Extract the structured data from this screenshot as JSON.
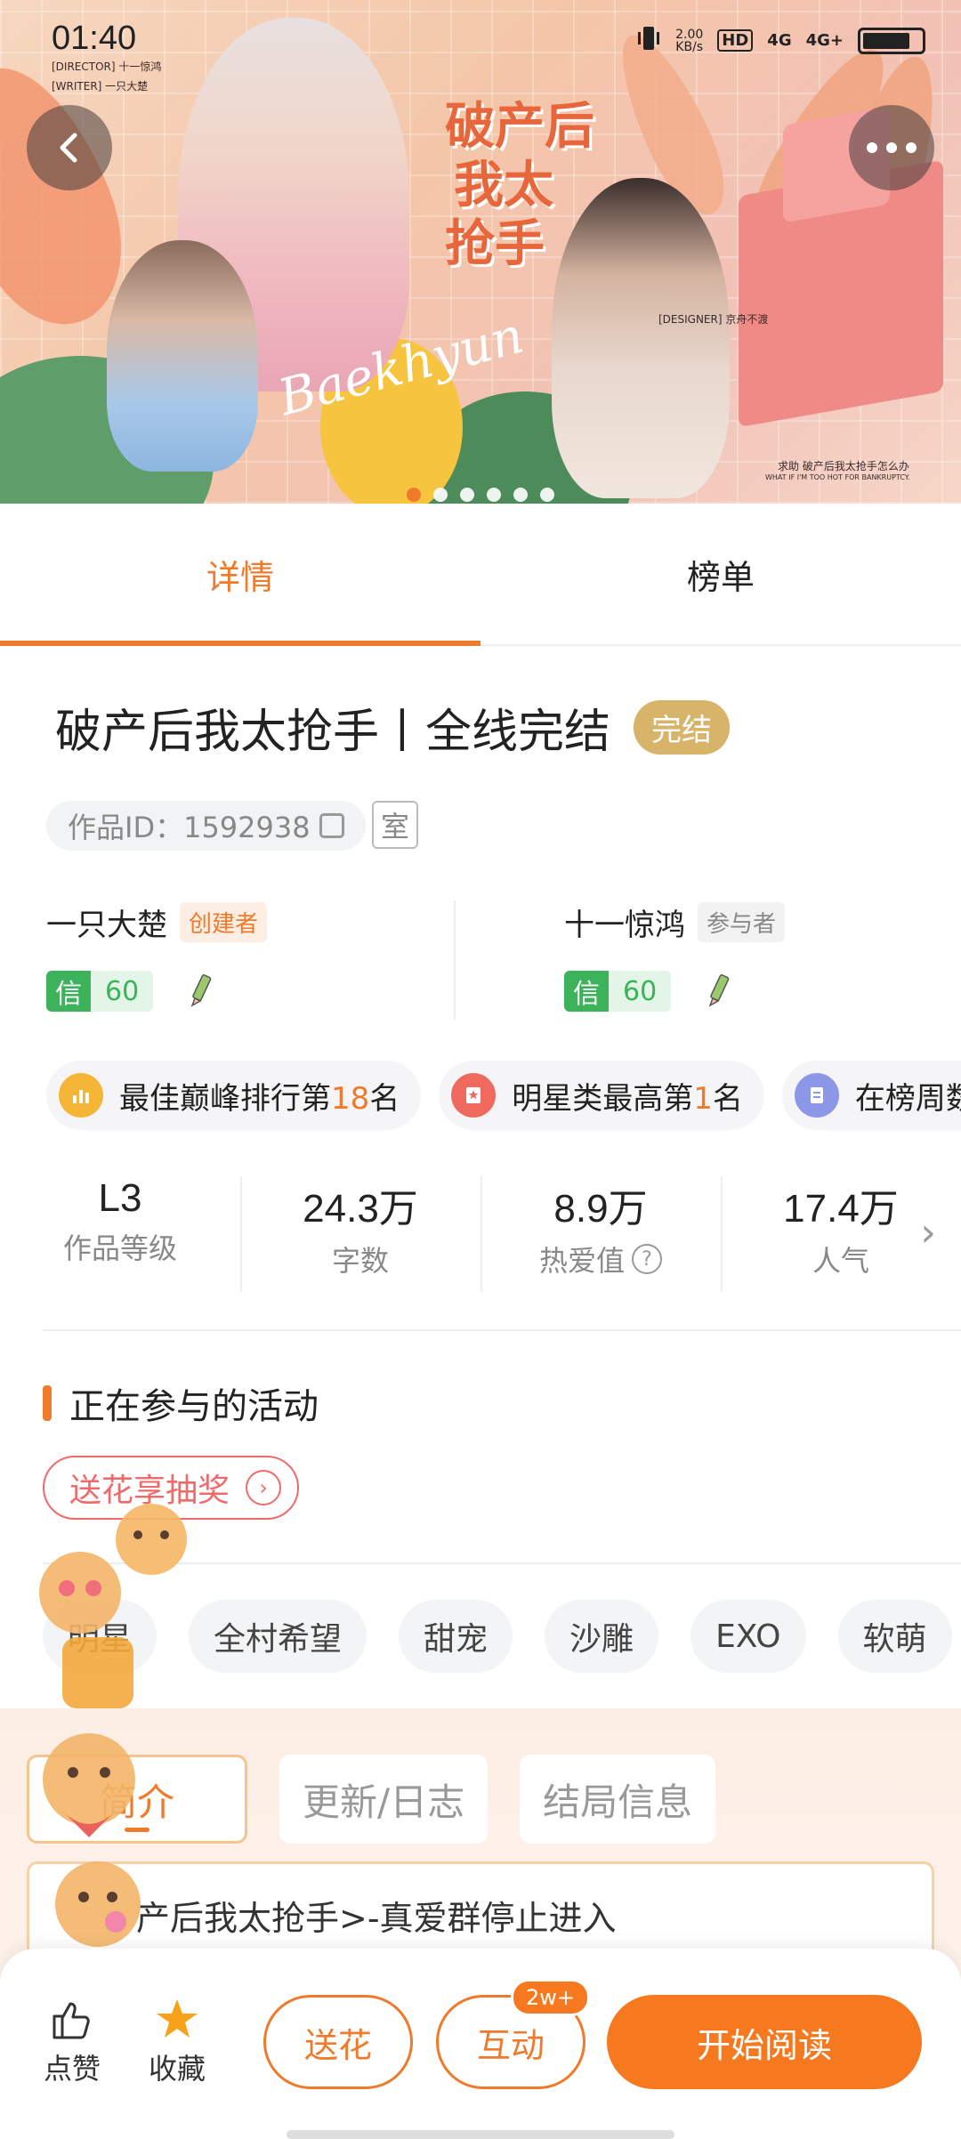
{
  "status_bar": {
    "time": "01:40",
    "net_speed_value": "2.00",
    "net_speed_unit": "KB/s",
    "hd_label": "HD",
    "signal_1": "4G",
    "signal_2": "4G+"
  },
  "banner": {
    "credits": {
      "director": "[DIRECTOR] 十一惊鸿",
      "writer": "[WRITER] 一只大楚",
      "designer": "[DESIGNER] 京舟不渡"
    },
    "title_art": [
      "破产后",
      "我太",
      "抢手"
    ],
    "signature_text": "Baekhyun",
    "caption_cn": "求助 破产后我太抢手怎么办",
    "caption_en": "WHAT IF I'M TOO HOT FOR BANKRUPTCY.",
    "slide_count": 6,
    "active_slide": 1
  },
  "tabs": [
    {
      "label": "详情",
      "active": true
    },
    {
      "label": "榜单",
      "active": false
    }
  ],
  "work": {
    "title": "破产后我太抢手丨全线完结",
    "status_badge": "完结",
    "id_text": "作品ID：1592938",
    "room_badge": "室"
  },
  "authors": [
    {
      "name": "一只大楚",
      "role": "创建者",
      "credit_key": "信",
      "credit_value": "60"
    },
    {
      "name": "十一惊鸿",
      "role": "参与者",
      "credit_key": "信",
      "credit_value": "60"
    }
  ],
  "rank_chips": [
    {
      "icon": "bar-chart-icon",
      "before": "最佳巅峰排行第",
      "num": "18",
      "after": "名",
      "color": "#f5b637"
    },
    {
      "icon": "star-list-icon",
      "before": "明星类最高第",
      "num": "1",
      "after": "名",
      "color": "#f0695e"
    },
    {
      "icon": "document-icon",
      "before": "在榜周数",
      "num": "",
      "after": "",
      "color": "#8d97e8"
    }
  ],
  "stats": [
    {
      "value": "L3",
      "label": "作品等级"
    },
    {
      "value": "24.3万",
      "label": "字数"
    },
    {
      "value": "8.9万",
      "label": "热爱值"
    },
    {
      "value": "17.4万",
      "label": "人气"
    }
  ],
  "activities": {
    "title": "正在参与的活动",
    "items": [
      "送花享抽奖"
    ]
  },
  "tags": [
    "明星",
    "全村希望",
    "甜宠",
    "沙雕",
    "EXO",
    "软萌"
  ],
  "intro": {
    "tabs": [
      {
        "label": "简介",
        "active": true
      },
      {
        "label": "更新/日志",
        "active": false
      },
      {
        "label": "结局信息",
        "active": false
      }
    ],
    "text": "产后我太抢手>-真爱群停止进入"
  },
  "bottom_bar": {
    "like_label": "点赞",
    "fav_label": "收藏",
    "flower_label": "送花",
    "interact_label": "互动",
    "interact_badge": "2w+",
    "read_label": "开始阅读"
  },
  "colors": {
    "accent": "#f07a2c",
    "credit_green": "#3cb35a",
    "done_gold": "#d8b46a"
  }
}
